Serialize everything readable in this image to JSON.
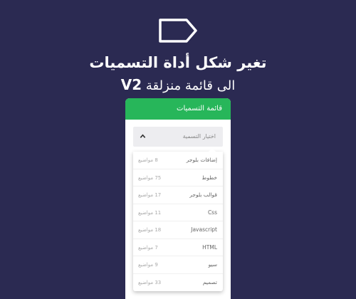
{
  "colors": {
    "background": "#2b2a52",
    "accent": "#27b65a",
    "white": "#ffffff"
  },
  "icons": {
    "hero": "label-tag-icon",
    "select": "chevron-up-icon"
  },
  "headline": {
    "line1": "تغير شكل أداة التسميات",
    "line2_text": "الى قائمة منزلقة",
    "line2_badge": "V2"
  },
  "widget": {
    "title": "قائمة التسميات",
    "select_label": "اختيار التسمية",
    "options": [
      {
        "name": "إضافات بلوجر",
        "count": "8 مواضيع"
      },
      {
        "name": "خطوط",
        "count": "75 مواضيع"
      },
      {
        "name": "قوالب بلوجر",
        "count": "17 مواضيع"
      },
      {
        "name": "Css",
        "count": "11 مواضيع"
      },
      {
        "name": "Javascript",
        "count": "18 مواضيع"
      },
      {
        "name": "HTML",
        "count": "7 مواضيع"
      },
      {
        "name": "سيو",
        "count": "9 مواضيع"
      },
      {
        "name": "تصميم",
        "count": "33 مواضيع"
      }
    ]
  }
}
